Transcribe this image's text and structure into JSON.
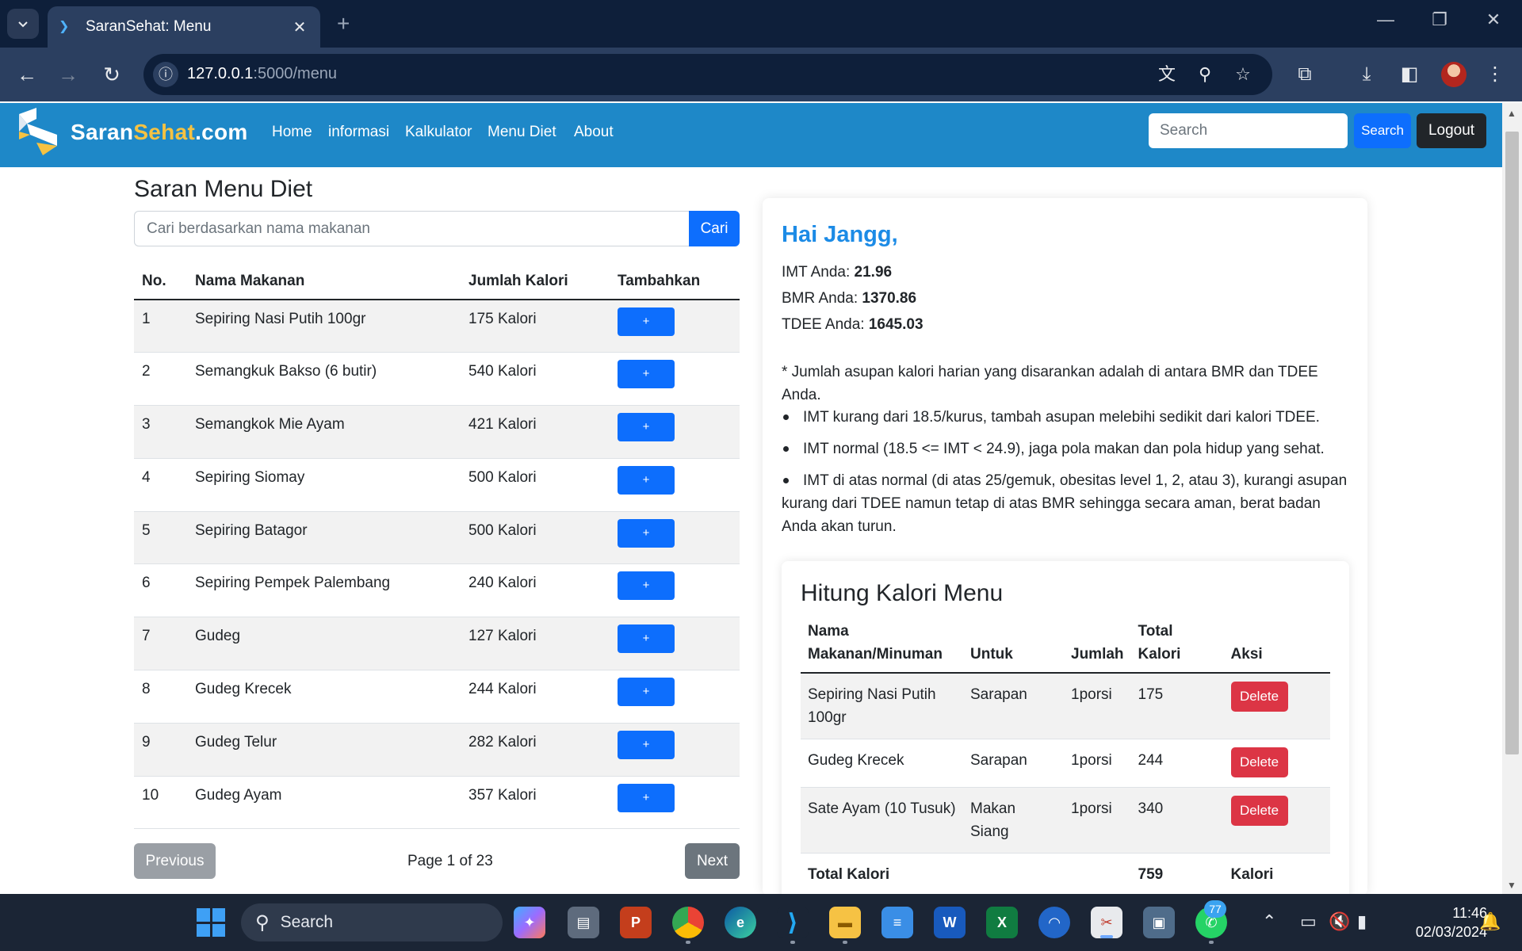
{
  "browser": {
    "tab_title": "SaranSehat: Menu",
    "tab_close_icon": "close-icon",
    "new_tab_icon": "plus-icon",
    "url_host": "127.0.0.1",
    "url_rest": ":5000/menu"
  },
  "site": {
    "brand_main": "Saran",
    "brand_accent": "Sehat",
    "brand_tail": ".com",
    "nav": [
      "Home",
      "informasi",
      "Kalkulator",
      "Menu Diet",
      "About"
    ],
    "search_placeholder": "Search",
    "search_button": "Search",
    "logout_button": "Logout",
    "colors": {
      "navbar": "#1e88c8",
      "primary": "#0d6efd",
      "danger": "#dc3545",
      "accent": "#f5c242",
      "greeting": "#1c8be6"
    }
  },
  "menu": {
    "title": "Saran Menu Diet",
    "search_placeholder": "Cari berdasarkan nama makanan",
    "search_button": "Cari",
    "headers": [
      "No.",
      "Nama Makanan",
      "Jumlah Kalori",
      "Tambahkan"
    ],
    "add_label": "+",
    "rows": [
      {
        "no": "1",
        "name": "Sepiring Nasi Putih 100gr",
        "kalori": "175 Kalori"
      },
      {
        "no": "2",
        "name": "Semangkuk Bakso (6 butir)",
        "kalori": "540 Kalori"
      },
      {
        "no": "3",
        "name": "Semangkok Mie Ayam",
        "kalori": "421 Kalori"
      },
      {
        "no": "4",
        "name": "Sepiring Siomay",
        "kalori": "500 Kalori"
      },
      {
        "no": "5",
        "name": "Sepiring Batagor",
        "kalori": "500 Kalori"
      },
      {
        "no": "6",
        "name": "Sepiring Pempek Palembang",
        "kalori": "240 Kalori"
      },
      {
        "no": "7",
        "name": "Gudeg",
        "kalori": "127 Kalori"
      },
      {
        "no": "8",
        "name": "Gudeg Krecek",
        "kalori": "244 Kalori"
      },
      {
        "no": "9",
        "name": "Gudeg Telur",
        "kalori": "282 Kalori"
      },
      {
        "no": "10",
        "name": "Gudeg Ayam",
        "kalori": "357 Kalori"
      }
    ],
    "prev_button": "Previous",
    "page_info": "Page 1 of 23",
    "next_button": "Next"
  },
  "summary": {
    "greeting": "Hai Jangg,",
    "imt_label": "IMT Anda: ",
    "imt_value": "21.96",
    "bmr_label": "BMR Anda: ",
    "bmr_value": "1370.86",
    "tdee_label": "TDEE Anda: ",
    "tdee_value": "1645.03",
    "note": "* Jumlah asupan kalori harian yang disarankan adalah di antara BMR dan TDEE Anda.",
    "bullets": [
      "IMT kurang dari 18.5/kurus, tambah asupan melebihi sedikit dari kalori TDEE.",
      "IMT normal (18.5 <= IMT < 24.9), jaga pola makan dan pola hidup yang sehat.",
      "IMT di atas normal (di atas 25/gemuk, obesitas level 1, 2, atau 3), kurangi asupan kurang dari TDEE namun tetap di atas BMR sehingga secara aman, berat badan Anda akan turun."
    ]
  },
  "calc": {
    "title": "Hitung Kalori Menu",
    "headers": [
      "Nama Makanan/Minuman",
      "Untuk",
      "Jumlah",
      "Total Kalori",
      "Aksi"
    ],
    "delete_label": "Delete",
    "rows": [
      {
        "name": "Sepiring Nasi Putih 100gr",
        "untuk": "Sarapan",
        "jumlah": "1porsi",
        "kalori": "175"
      },
      {
        "name": "Gudeg Krecek",
        "untuk": "Sarapan",
        "jumlah": "1porsi",
        "kalori": "244"
      },
      {
        "name": "Sate Ayam (10 Tusuk)",
        "untuk": "Makan Siang",
        "jumlah": "1porsi",
        "kalori": "340"
      }
    ],
    "total_label": "Total Kalori",
    "total_value": "759",
    "total_unit": "Kalori"
  },
  "taskbar": {
    "search_label": "Search",
    "whatsapp_badge": "77",
    "time": "11:46",
    "date": "02/03/2024"
  }
}
